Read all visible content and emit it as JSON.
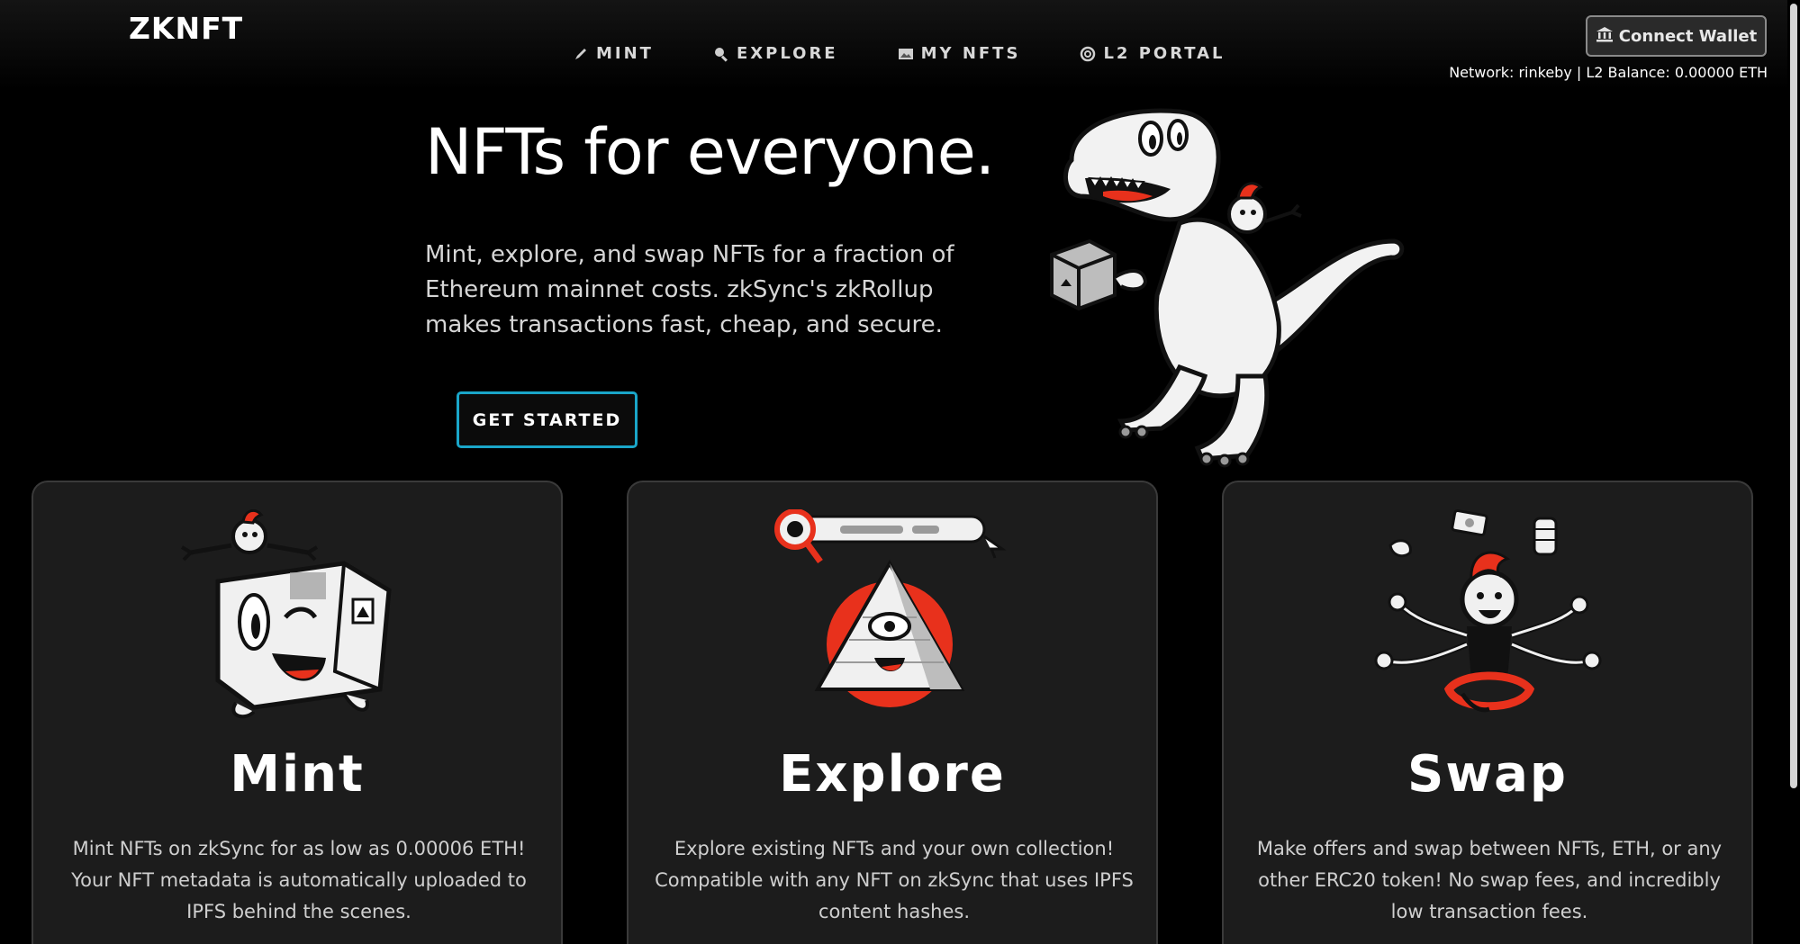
{
  "brand": {
    "logo": "ZKNFT"
  },
  "nav": {
    "items": [
      {
        "label": "MINT",
        "icon": "pencil-icon"
      },
      {
        "label": "EXPLORE",
        "icon": "magnifier-icon"
      },
      {
        "label": "MY NFTS",
        "icon": "picture-icon"
      },
      {
        "label": "L2 PORTAL",
        "icon": "portal-icon"
      }
    ]
  },
  "wallet": {
    "button_label": "Connect Wallet",
    "button_icon": "bank-icon",
    "network_status": "Network: rinkeby | L2 Balance: 0.00000 ETH"
  },
  "hero": {
    "title": "NFTs for everyone.",
    "description": "Mint, explore, and swap NFTs for a fraction of Ethereum mainnet costs. zkSync's zkRollup makes transactions fast, cheap, and secure.",
    "cta_label": "GET STARTED",
    "illustration": "dinosaur-illustration"
  },
  "features": [
    {
      "title": "Mint",
      "description": "Mint NFTs on zkSync for as low as 0.00006 ETH! Your NFT metadata is automatically uploaded to IPFS behind the scenes.",
      "illustration": "mint-box-illustration"
    },
    {
      "title": "Explore",
      "description": "Explore existing NFTs and your own collection! Compatible with any NFT on zkSync that uses IPFS content hashes.",
      "illustration": "explore-pyramid-illustration"
    },
    {
      "title": "Swap",
      "description": "Make offers and swap between NFTs, ETH, or any other ERC20 token! No swap fees, and incredibly low transaction fees.",
      "illustration": "swap-juggler-illustration"
    }
  ],
  "colors": {
    "background": "#000000",
    "card": "#1c1c1c",
    "accent_cyan": "#1aa6c9",
    "accent_red": "#e8311c"
  }
}
